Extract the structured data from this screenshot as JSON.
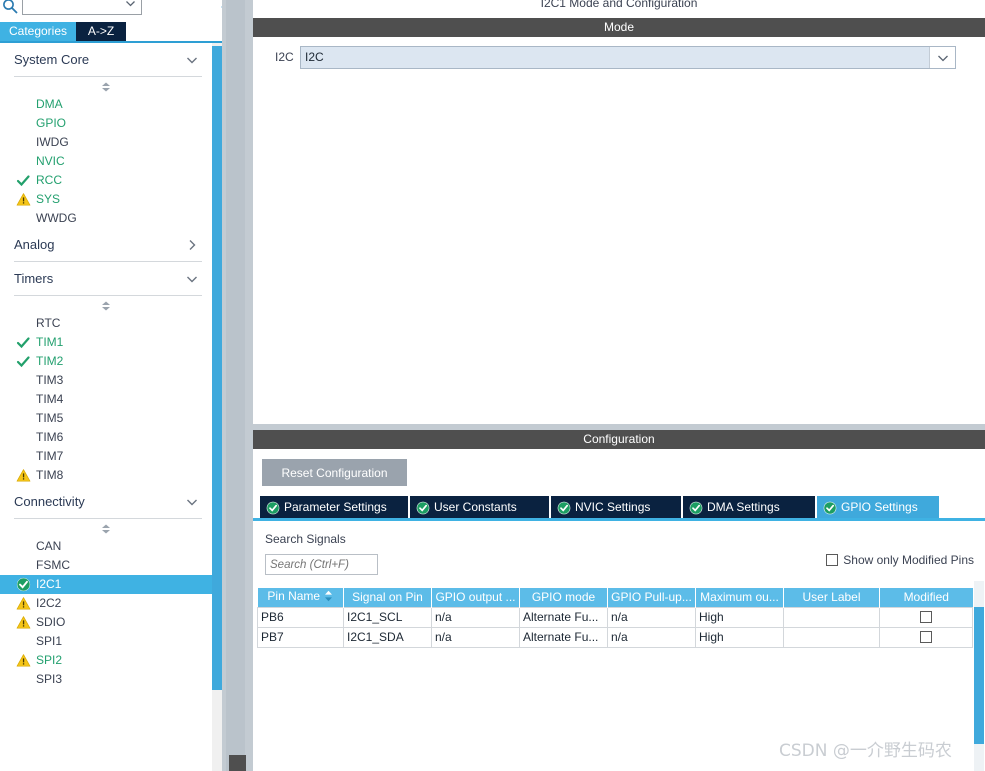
{
  "left_panel": {
    "search": {
      "value": "",
      "placeholder": ""
    },
    "gear_icon": "gear-icon",
    "search_icon": "search-icon",
    "tabs": [
      {
        "label": "Categories",
        "active": true
      },
      {
        "label": "A->Z",
        "active": false
      }
    ],
    "groups": [
      {
        "title": "System Core",
        "expanded": true,
        "items": [
          {
            "label": "DMA",
            "status": "configured-green",
            "green": true
          },
          {
            "label": "GPIO",
            "status": "configured-green",
            "green": true
          },
          {
            "label": "IWDG",
            "status": "none",
            "green": false
          },
          {
            "label": "NVIC",
            "status": "configured-green",
            "green": true
          },
          {
            "label": "RCC",
            "status": "check",
            "green": true
          },
          {
            "label": "SYS",
            "status": "warning",
            "green": true
          },
          {
            "label": "WWDG",
            "status": "none",
            "green": false
          }
        ]
      },
      {
        "title": "Analog",
        "expanded": false,
        "items": []
      },
      {
        "title": "Timers",
        "expanded": true,
        "items": [
          {
            "label": "RTC",
            "status": "none",
            "green": false
          },
          {
            "label": "TIM1",
            "status": "check",
            "green": true
          },
          {
            "label": "TIM2",
            "status": "check",
            "green": true
          },
          {
            "label": "TIM3",
            "status": "none",
            "green": false
          },
          {
            "label": "TIM4",
            "status": "none",
            "green": false
          },
          {
            "label": "TIM5",
            "status": "none",
            "green": false
          },
          {
            "label": "TIM6",
            "status": "none",
            "green": false
          },
          {
            "label": "TIM7",
            "status": "none",
            "green": false
          },
          {
            "label": "TIM8",
            "status": "warning",
            "green": false
          }
        ]
      },
      {
        "title": "Connectivity",
        "expanded": true,
        "items": [
          {
            "label": "CAN",
            "status": "none",
            "green": false
          },
          {
            "label": "FSMC",
            "status": "none",
            "green": false
          },
          {
            "label": "I2C1",
            "status": "check-filled",
            "green": false,
            "selected": true
          },
          {
            "label": "I2C2",
            "status": "warning",
            "green": false
          },
          {
            "label": "SDIO",
            "status": "warning",
            "green": false
          },
          {
            "label": "SPI1",
            "status": "none",
            "green": false
          },
          {
            "label": "SPI2",
            "status": "warning",
            "green": true
          },
          {
            "label": "SPI3",
            "status": "none",
            "green": false
          }
        ]
      }
    ]
  },
  "main": {
    "title": "I2C1 Mode and Configuration",
    "mode": {
      "bar_label": "Mode",
      "i2c_label": "I2C",
      "i2c_value": "I2C"
    },
    "configuration": {
      "bar_label": "Configuration",
      "reset_button": "Reset Configuration",
      "tabs": [
        {
          "label": "Parameter Settings",
          "active": false
        },
        {
          "label": "User Constants",
          "active": false
        },
        {
          "label": "NVIC Settings",
          "active": false
        },
        {
          "label": "DMA Settings",
          "active": false
        },
        {
          "label": "GPIO Settings",
          "active": true
        }
      ],
      "gpio": {
        "search_signals_label": "Search Signals",
        "search_placeholder": "Search (Ctrl+F)",
        "search_value": "",
        "show_modified_label": "Show only Modified Pins",
        "show_modified_checked": false,
        "columns": [
          "Pin Name",
          "Signal on Pin",
          "GPIO output ...",
          "GPIO mode",
          "GPIO Pull-up...",
          "Maximum ou...",
          "User Label",
          "Modified"
        ],
        "rows": [
          {
            "pin_name": "PB6",
            "signal_on_pin": "I2C1_SCL",
            "gpio_output": "n/a",
            "gpio_mode": "Alternate Fu...",
            "gpio_pullup": "n/a",
            "maximum_output": "High",
            "user_label": "",
            "modified": false
          },
          {
            "pin_name": "PB7",
            "signal_on_pin": "I2C1_SDA",
            "gpio_output": "n/a",
            "gpio_mode": "Alternate Fu...",
            "gpio_pullup": "n/a",
            "maximum_output": "High",
            "user_label": "",
            "modified": false
          }
        ]
      }
    }
  },
  "watermark": "CSDN @一介野生码农",
  "colors": {
    "accent_cyan": "#3fb2e3",
    "tab_navy": "#0a2240",
    "bar_gray": "#4f4f4f",
    "table_header": "#5cbce8",
    "green_check": "#22a06b",
    "warning_yellow": "#f5c518",
    "combo_blue": "#dce6f1"
  }
}
